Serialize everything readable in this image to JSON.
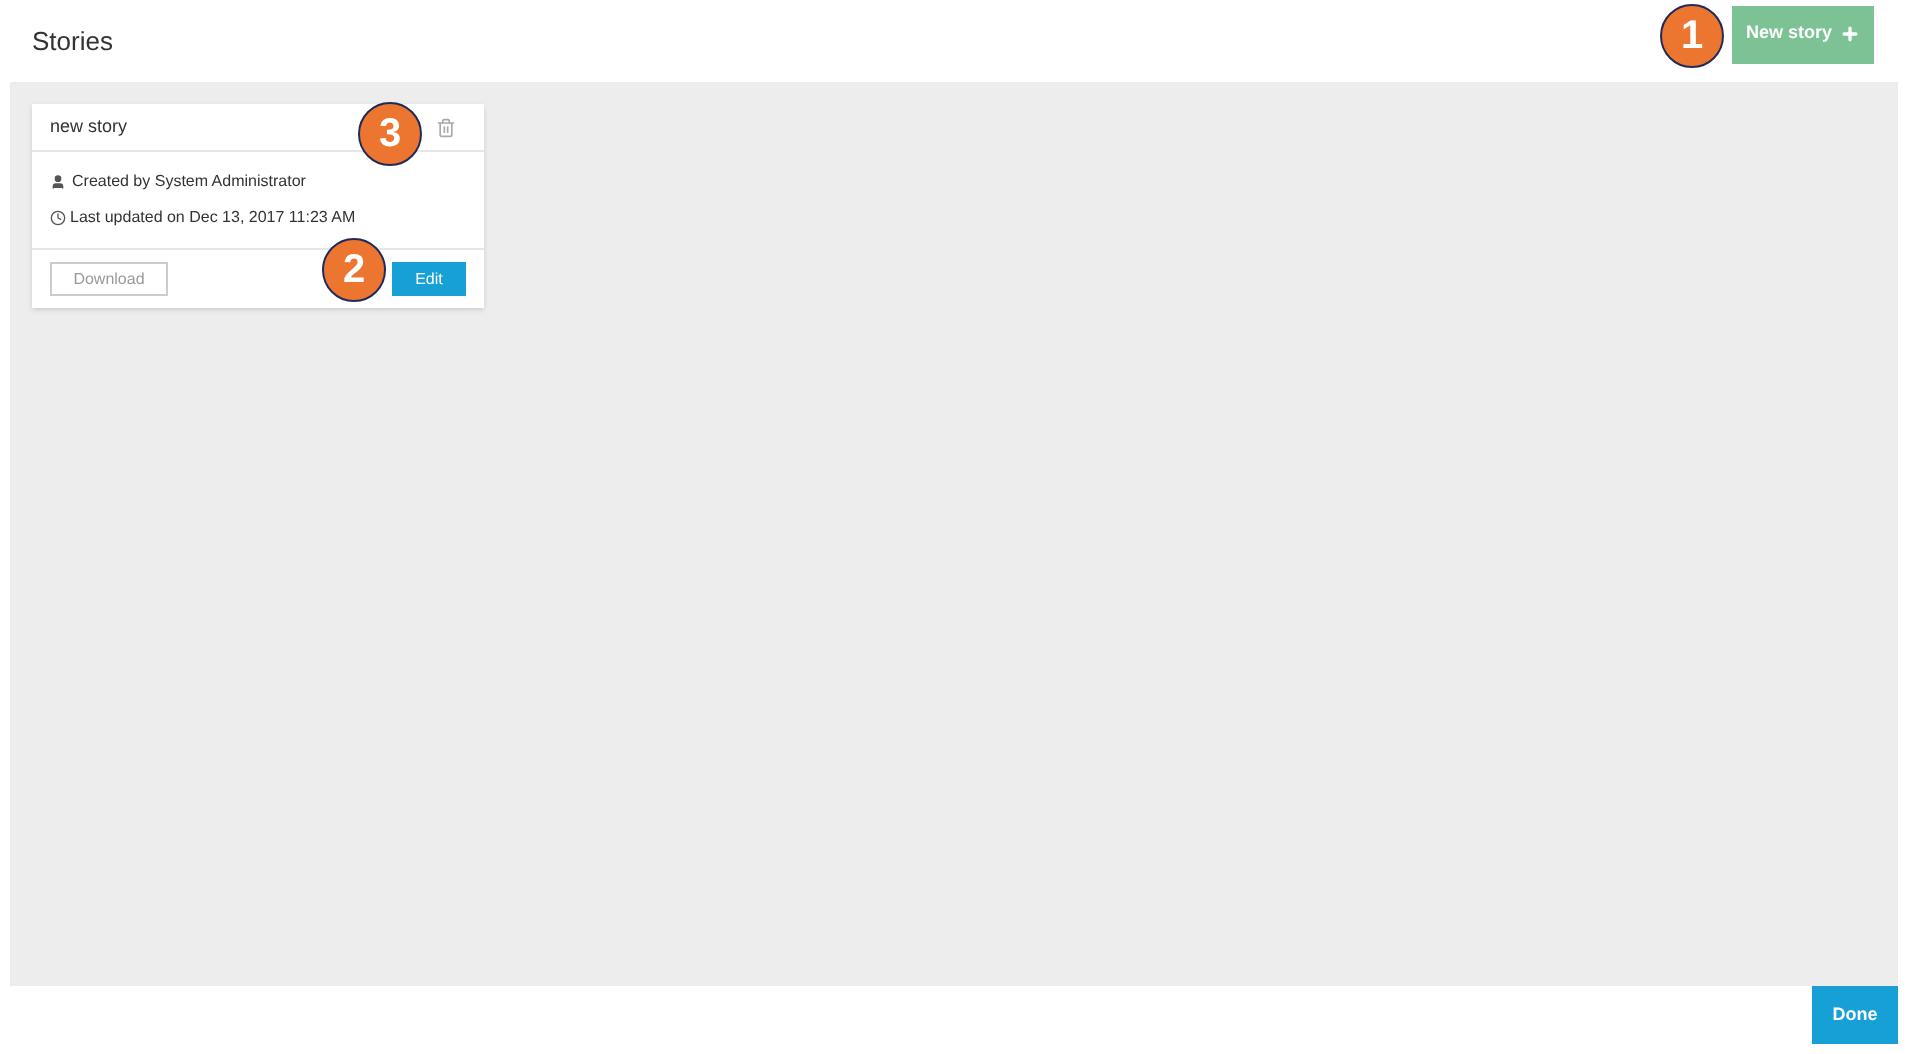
{
  "header": {
    "title": "Stories",
    "new_button": "New story"
  },
  "stories": [
    {
      "title": "new story",
      "created_by": "Created by System Administrator",
      "updated": "Last updated on Dec 13, 2017 11:23 AM",
      "download": "Download",
      "edit": "Edit"
    }
  ],
  "footer": {
    "done": "Done"
  },
  "callouts": [
    {
      "label": "1"
    },
    {
      "label": "3"
    },
    {
      "label": "2"
    }
  ]
}
